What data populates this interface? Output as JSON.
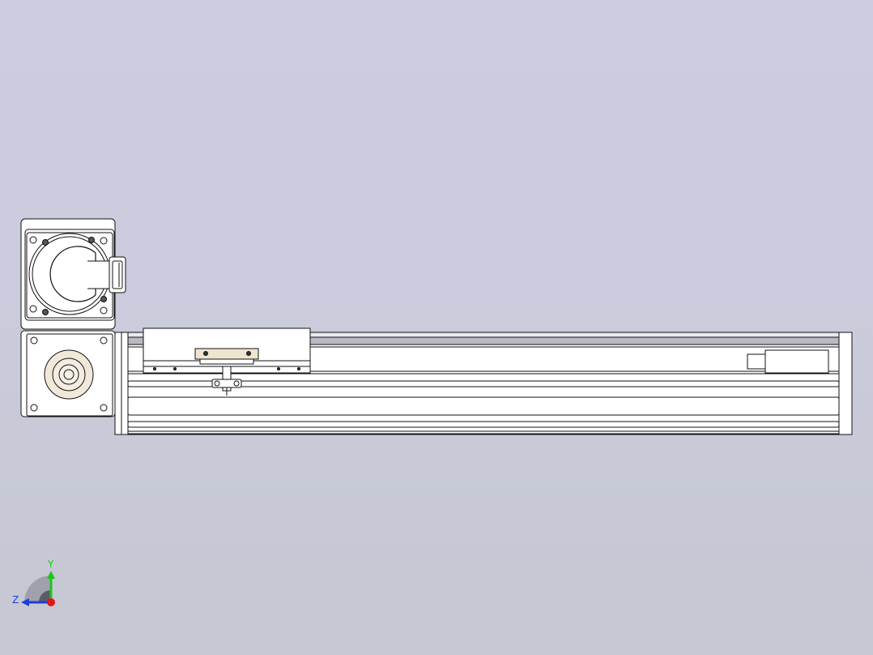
{
  "viewport": {
    "background_top": "#cdcde2",
    "background_bottom": "#c5c8d2"
  },
  "model": {
    "part_fill": "#ffffff",
    "edge_color": "#111111",
    "rail_color": "#9a9aa6",
    "coupling_color": "#f2e8da",
    "bracket_color": "#efe4cf"
  },
  "triad": {
    "y_label": "Y",
    "z_label": "Z",
    "y_color": "#1fc41f",
    "z_color": "#1f3fd6",
    "x_color": "#e01818"
  }
}
